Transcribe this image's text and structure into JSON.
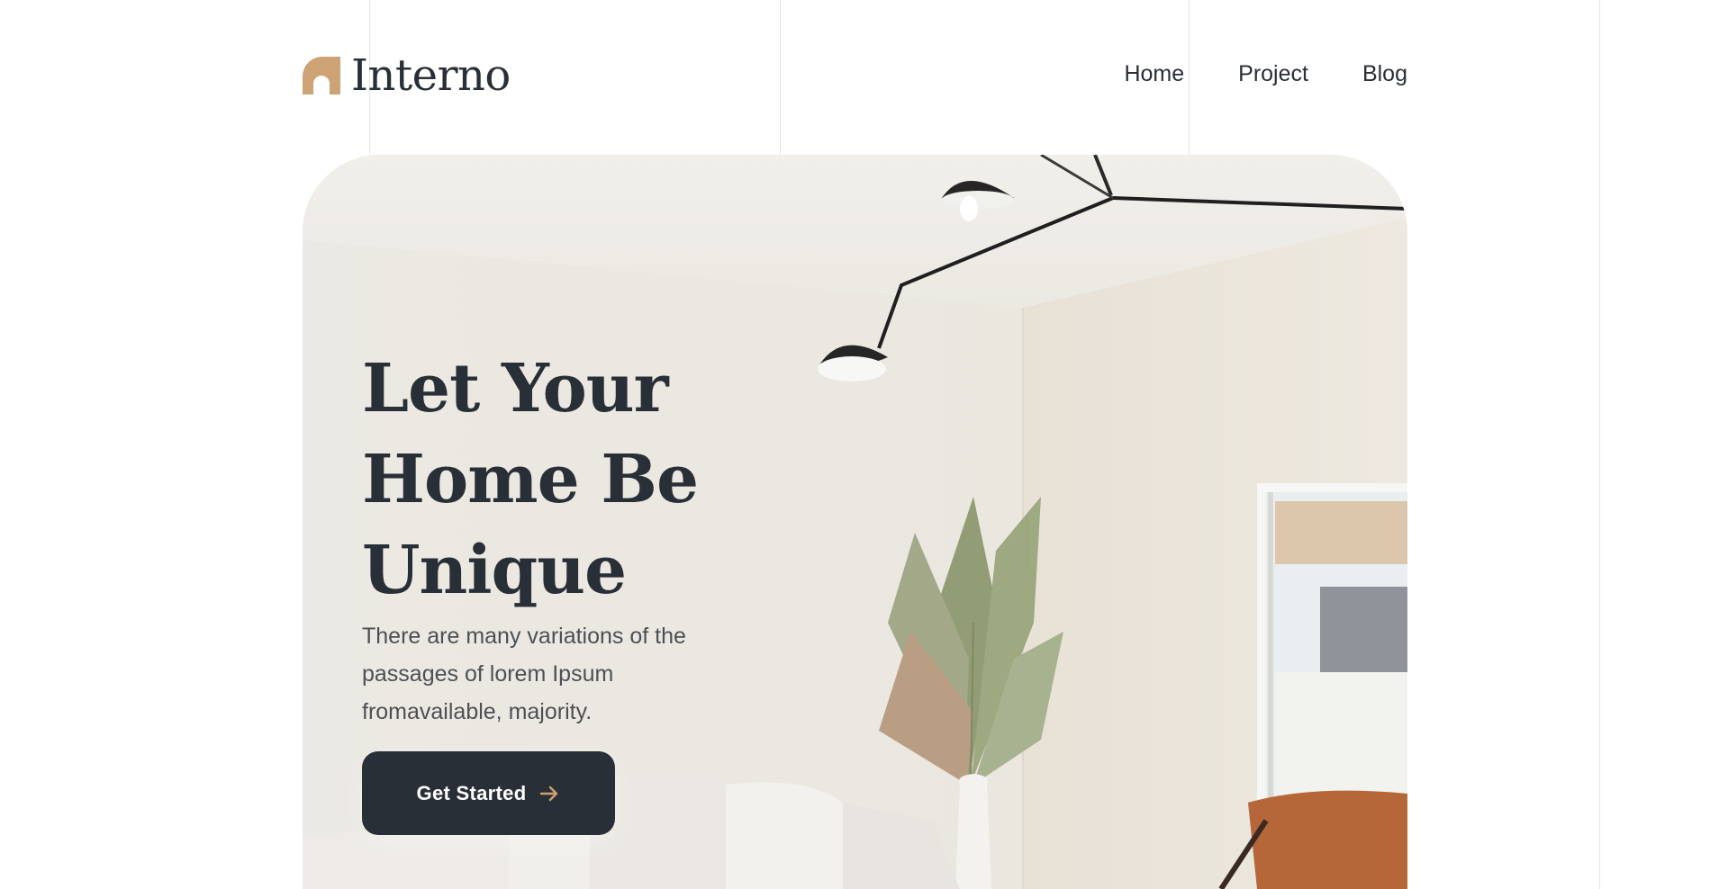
{
  "brand": {
    "name": "Interno",
    "logo_icon": "arch-logo-icon",
    "accent_color": "#CDA274"
  },
  "nav": {
    "items": [
      {
        "label": "Home"
      },
      {
        "label": "Project"
      },
      {
        "label": "Blog"
      }
    ]
  },
  "hero": {
    "title_lines": [
      "Let Your",
      "Home Be",
      "Unique"
    ],
    "subtitle": "There are many variations of the passages of lorem Ipsum fromavailable, majority.",
    "cta": {
      "label": "Get Started",
      "icon": "arrow-right-icon"
    },
    "image_icon": "living-room-photo"
  },
  "colors": {
    "text_dark": "#292F36",
    "text_body": "#4D5053",
    "button_bg": "#292F36",
    "button_text": "#FFFFFF"
  }
}
